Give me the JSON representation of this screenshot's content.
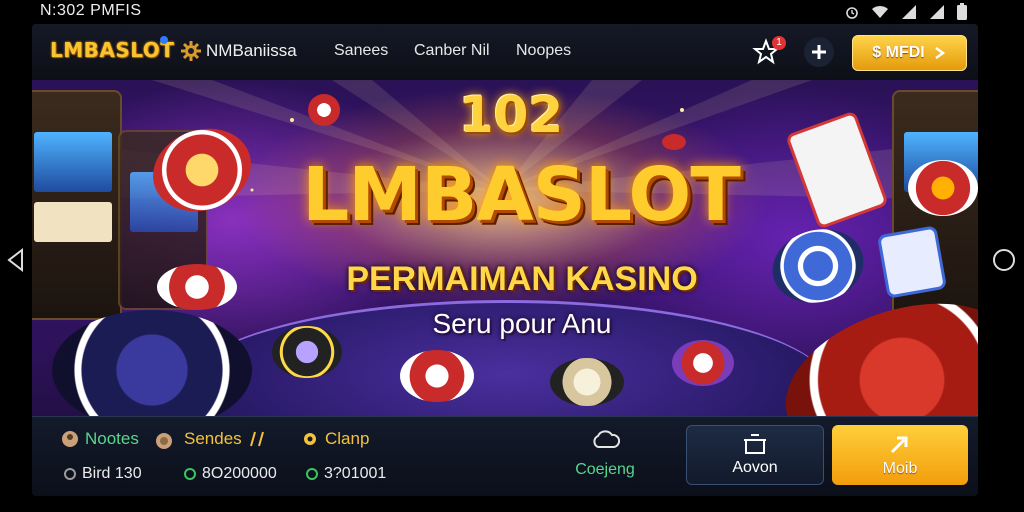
{
  "status_bar": {
    "time": "N:302  PMFIS"
  },
  "header": {
    "logo": "LMBASLOT",
    "brand2": "NMBaniissa",
    "nav": [
      "Sanees",
      "Canber Nil",
      "Noopes"
    ],
    "notification_count": "1",
    "cta_label": "$ MFDI"
  },
  "hero": {
    "number": "102",
    "title": "LMBASLOT",
    "subtitle": "PERMAIMAN KASINO",
    "tagline": "Seru pour Anu"
  },
  "bottom": {
    "tabs": [
      {
        "label": "Nootes",
        "color": "#58d68d"
      },
      {
        "label": "Sendes",
        "color": "#f5c23b"
      },
      {
        "label": "Clanp",
        "color": "#f5c23b"
      }
    ],
    "stats": [
      "Bird 130",
      "8O200000",
      "3?01001"
    ],
    "center_label": "Coejeng",
    "btn_dark_label": "Aovon",
    "btn_gold_label": "Moib"
  },
  "icons": {
    "wifi": "wifi-icon",
    "signal": "signal-icon",
    "battery": "battery-icon",
    "star": "star-icon",
    "plus": "plus-icon",
    "arrow": "arrow-icon",
    "cloud": "cloud-icon",
    "box": "box-icon"
  },
  "colors": {
    "gold": "#f7c531",
    "purple": "#3b1476",
    "green": "#58d68d"
  }
}
